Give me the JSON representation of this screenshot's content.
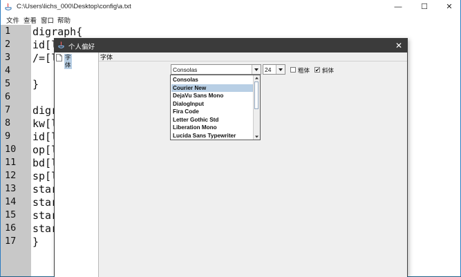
{
  "window": {
    "title": "C:\\Users\\lichs_000\\Desktop\\config\\a.txt",
    "minimize": "—",
    "maximize": "☐",
    "close": "✕"
  },
  "menu": [
    "文件",
    "查看",
    "窗口",
    "帮助"
  ],
  "editor": {
    "line_numbers": [
      "1",
      "2",
      "3",
      "4",
      "5",
      "6",
      "7",
      "8",
      "9",
      "10",
      "11",
      "12",
      "13",
      "14",
      "15",
      "16",
      "17"
    ],
    "lines": [
      "digraph{",
      "id[l",
      "/=[l",
      "",
      "}",
      "",
      "digr",
      "kw[l",
      "id[l",
      "op[l",
      "bd[l",
      "sp[l",
      "star",
      "star",
      "star",
      "star",
      "}"
    ]
  },
  "dialog": {
    "title": "个人偏好",
    "close": "✕",
    "tree_item": "字体",
    "panel_title": "字体",
    "font_combo_value": "Consolas",
    "size_combo_value": "24",
    "bold_label": "粗体",
    "bold_checked": false,
    "italic_label": "斜体",
    "italic_checked": true,
    "check_mark": "✔",
    "font_options": [
      "Consolas",
      "Courier New",
      "DejaVu Sans Mono",
      "DialogInput",
      "Fira Code",
      "Letter Gothic Std",
      "Liberation Mono",
      "Lucida Sans Typewriter"
    ],
    "selected_option": "Courier New"
  },
  "colors": {
    "selection": "#b8cfe5",
    "dialog_title_bg": "#3b3b3b",
    "window_border": "#2b7bc0"
  }
}
